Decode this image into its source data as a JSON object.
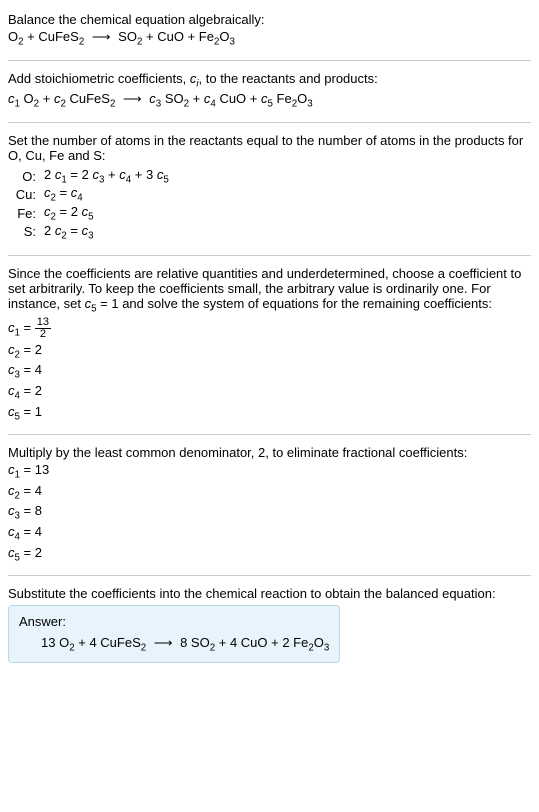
{
  "section1": {
    "intro": "Balance the chemical equation algebraically:",
    "eq_left_o2": "O",
    "eq_left_cufes2": " + CuFeS",
    "arrow": "⟶",
    "eq_right_so2": "SO",
    "eq_right_cuo": " + CuO + Fe",
    "eq_right_o3": "O"
  },
  "section2": {
    "line1a": "Add stoichiometric coefficients, ",
    "line1b": ", to the reactants and products:",
    "ci": "c",
    "ci_sub": "i",
    "c1": "c",
    "c2": "c",
    "c3": "c",
    "c4": "c",
    "c5": "c",
    "o2": " O",
    "plus": " + ",
    "cufes2": " CuFeS",
    "arrow": "⟶",
    "so2": " SO",
    "cuo": " CuO + ",
    "fe2o3": " Fe",
    "o3": "O"
  },
  "section3": {
    "line1": "Set the number of atoms in the reactants equal to the number of atoms in the products for O, Cu, Fe and S:",
    "atoms": [
      {
        "label": "O:",
        "eq_parts": [
          "2 ",
          "c",
          "1",
          " = 2 ",
          "c",
          "3",
          " + ",
          "c",
          "4",
          " + 3 ",
          "c",
          "5"
        ]
      },
      {
        "label": "Cu:",
        "eq_parts": [
          "",
          "c",
          "2",
          " = ",
          "c",
          "4",
          "",
          "",
          "",
          "",
          "",
          ""
        ]
      },
      {
        "label": "Fe:",
        "eq_parts": [
          "",
          "c",
          "2",
          " = 2 ",
          "c",
          "5",
          "",
          "",
          "",
          "",
          "",
          ""
        ]
      },
      {
        "label": "S:",
        "eq_parts": [
          "2 ",
          "c",
          "2",
          " = ",
          "c",
          "3",
          "",
          "",
          "",
          "",
          "",
          ""
        ]
      }
    ]
  },
  "section4": {
    "text": "Since the coefficients are relative quantities and underdetermined, choose a coefficient to set arbitrarily. To keep the coefficients small, the arbitrary value is ordinarily one. For instance, set ",
    "c5": "c",
    "text2": " = 1 and solve the system of equations for the remaining coefficients:",
    "coeffs": [
      {
        "c": "c",
        "sub": "1",
        "eq": " = ",
        "frac_num": "13",
        "frac_den": "2"
      },
      {
        "c": "c",
        "sub": "2",
        "eq": " = 2"
      },
      {
        "c": "c",
        "sub": "3",
        "eq": " = 4"
      },
      {
        "c": "c",
        "sub": "4",
        "eq": " = 2"
      },
      {
        "c": "c",
        "sub": "5",
        "eq": " = 1"
      }
    ]
  },
  "section5": {
    "text": "Multiply by the least common denominator, 2, to eliminate fractional coefficients:",
    "coeffs": [
      {
        "c": "c",
        "sub": "1",
        "eq": " = 13"
      },
      {
        "c": "c",
        "sub": "2",
        "eq": " = 4"
      },
      {
        "c": "c",
        "sub": "3",
        "eq": " = 8"
      },
      {
        "c": "c",
        "sub": "4",
        "eq": " = 4"
      },
      {
        "c": "c",
        "sub": "5",
        "eq": " = 2"
      }
    ]
  },
  "section6": {
    "text": "Substitute the coefficients into the chemical reaction to obtain the balanced equation:",
    "answer_label": "Answer:",
    "eq": {
      "c1": "13 O",
      "plus1": " + 4 CuFeS",
      "arrow": "⟶",
      "c3": "8 SO",
      "plus2": " + 4 CuO + 2 Fe",
      "o3": "O"
    }
  }
}
